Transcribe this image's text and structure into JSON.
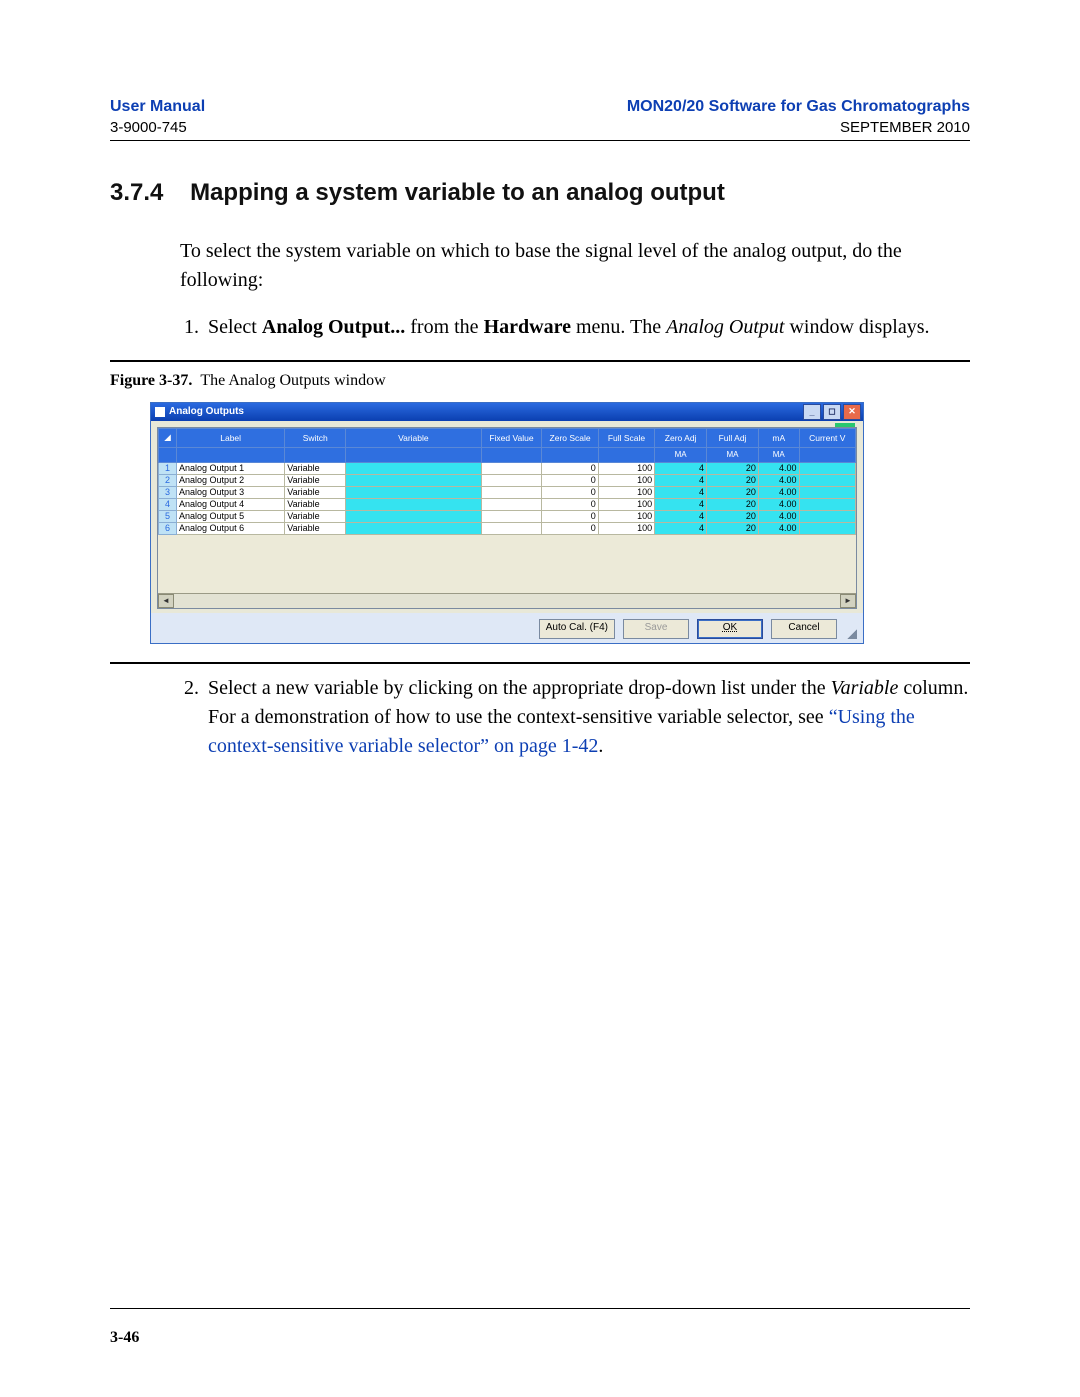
{
  "header": {
    "left_title": "User Manual",
    "left_sub": "3-9000-745",
    "right_title": "MON20/20 Software for Gas Chromatographs",
    "right_sub": "SEPTEMBER 2010"
  },
  "section": {
    "number": "3.7.4",
    "title": "Mapping a system variable to an analog output",
    "intro": "To select the system variable on which to base the signal level of the analog output, do the following:",
    "step1_a": "Select ",
    "step1_bold1": "Analog Output...",
    "step1_b": " from the ",
    "step1_bold2": "Hardware",
    "step1_c": " menu.  The ",
    "step1_italic": "Analog Output",
    "step1_d": " window displays.",
    "step2_a": "Select a new variable by clicking on the appropriate drop-down list under the ",
    "step2_italic": "Variable",
    "step2_b": " column.  For a demonstration of how to use the context-sensitive variable selector, see ",
    "step2_link": "“Using the context-sensitive variable selector” on page 1-42",
    "step2_c": "."
  },
  "figure": {
    "label": "Figure 3-37.",
    "caption": "The Analog Outputs window"
  },
  "window": {
    "title": "Analog Outputs",
    "columns": [
      "",
      "Label",
      "Switch",
      "Variable",
      "Fixed Value",
      "Zero Scale",
      "Full Scale",
      "Zero Adj",
      "Full Adj",
      "mA",
      "Current V"
    ],
    "sub_units": {
      "zero_adj": "MA",
      "full_adj": "MA",
      "ma": "MA"
    },
    "rows": [
      {
        "n": "1",
        "label": "Analog Output 1",
        "switch": "Variable",
        "variable": "",
        "fixed": "",
        "zero": "0",
        "full": "100",
        "zadj": "4",
        "fadj": "20",
        "ma": "4.00",
        "cur": ""
      },
      {
        "n": "2",
        "label": "Analog Output 2",
        "switch": "Variable",
        "variable": "",
        "fixed": "",
        "zero": "0",
        "full": "100",
        "zadj": "4",
        "fadj": "20",
        "ma": "4.00",
        "cur": ""
      },
      {
        "n": "3",
        "label": "Analog Output 3",
        "switch": "Variable",
        "variable": "",
        "fixed": "",
        "zero": "0",
        "full": "100",
        "zadj": "4",
        "fadj": "20",
        "ma": "4.00",
        "cur": ""
      },
      {
        "n": "4",
        "label": "Analog Output 4",
        "switch": "Variable",
        "variable": "",
        "fixed": "",
        "zero": "0",
        "full": "100",
        "zadj": "4",
        "fadj": "20",
        "ma": "4.00",
        "cur": ""
      },
      {
        "n": "5",
        "label": "Analog Output 5",
        "switch": "Variable",
        "variable": "",
        "fixed": "",
        "zero": "0",
        "full": "100",
        "zadj": "4",
        "fadj": "20",
        "ma": "4.00",
        "cur": ""
      },
      {
        "n": "6",
        "label": "Analog Output 6",
        "switch": "Variable",
        "variable": "",
        "fixed": "",
        "zero": "0",
        "full": "100",
        "zadj": "4",
        "fadj": "20",
        "ma": "4.00",
        "cur": ""
      }
    ],
    "buttons": {
      "autocal": "Auto Cal. (F4)",
      "save": "Save",
      "ok": "OK",
      "cancel": "Cancel"
    }
  },
  "page_number": "3-46"
}
